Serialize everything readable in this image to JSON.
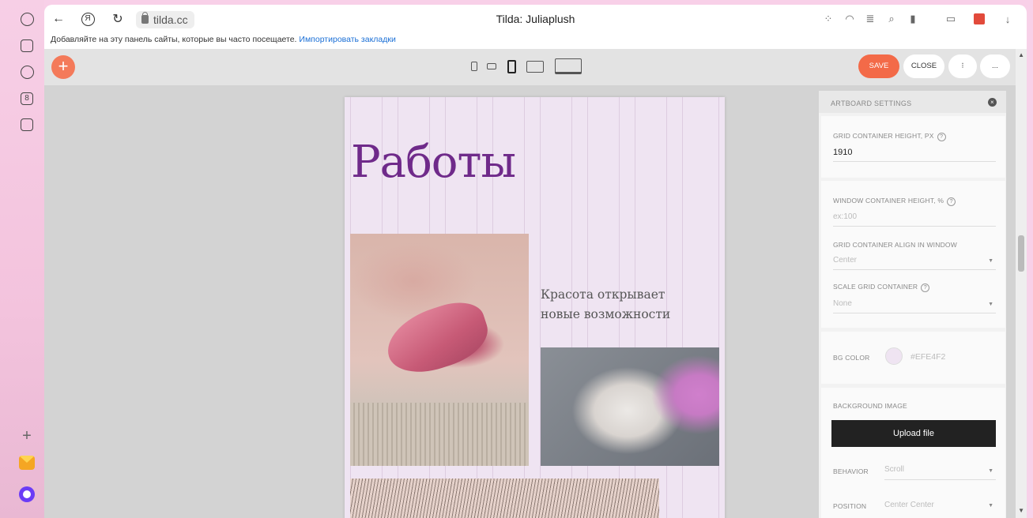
{
  "browser": {
    "url": "tilda.cc",
    "page_title": "Tilda: Juliaplush",
    "bookmarks_text": "Добавляйте на эту панель сайты, которые вы часто посещаете.",
    "bookmarks_link": "Импортировать закладки",
    "yandex_glyph": "Я",
    "sidebar_tile_label": "8"
  },
  "editor": {
    "add_icon": "+",
    "save_label": "SAVE",
    "close_label": "CLOSE",
    "more_label_1": "⁝",
    "more_label_2": "...",
    "accent_color": "#f36a48"
  },
  "artboard": {
    "heading": "Работы",
    "subtext": "Красота открывает новые возможности",
    "bg_color": "#EFE4F2",
    "heading_color": "#6f2a8a"
  },
  "settings": {
    "title": "ARTBOARD SETTINGS",
    "grid_height_label": "GRID CONTAINER HEIGHT, PX",
    "grid_height_value": "1910",
    "window_height_label": "WINDOW CONTAINER HEIGHT, %",
    "window_height_placeholder": "ex:100",
    "align_label": "GRID CONTAINER ALIGN IN WINDOW",
    "align_value": "Center",
    "scale_label": "SCALE GRID CONTAINER",
    "scale_value": "None",
    "bg_color_label": "BG COLOR",
    "bg_color_value": "#EFE4F2",
    "bg_image_label": "BACKGROUND IMAGE",
    "upload_label": "Upload file",
    "behavior_label": "BEHAVIOR",
    "behavior_value": "Scroll",
    "position_label": "POSITION",
    "position_value": "Center Center",
    "question_mark": "?"
  }
}
